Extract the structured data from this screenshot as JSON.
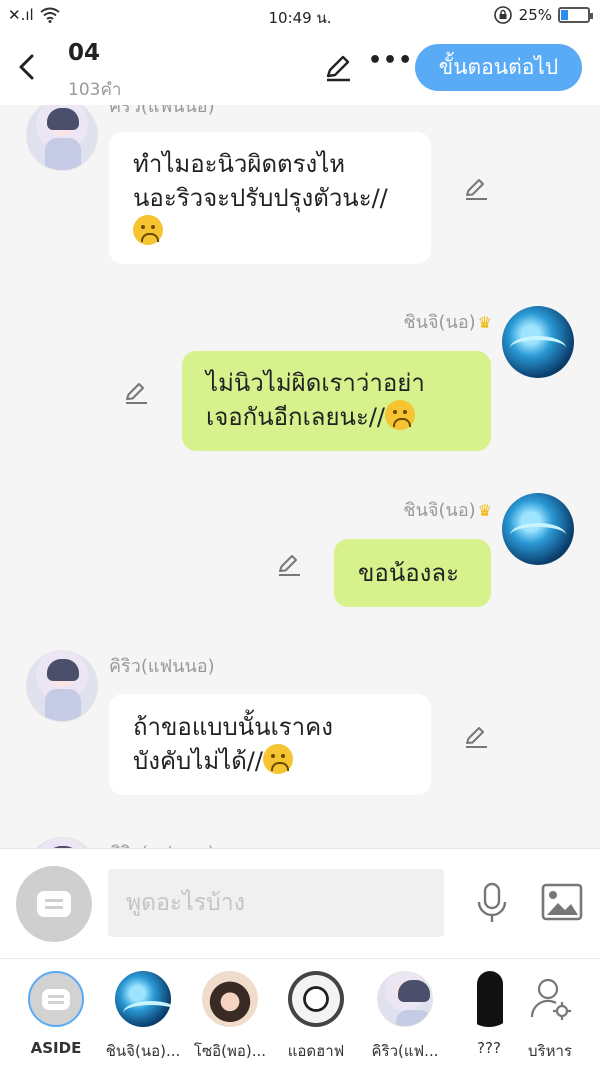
{
  "status_bar": {
    "signal": "✕.ıl",
    "time": "10:49 น.",
    "battery_percent": "25%",
    "battery_level": 0.25
  },
  "header": {
    "back_icon": "chevron-left",
    "title": "04",
    "subtitle": "103คำ",
    "next_button": "ขั้นตอนต่อไป"
  },
  "messages": [
    {
      "side": "left",
      "sender": "คิริว(แฟนนอ)",
      "lines": [
        "ทำไมอะนิวผิดตรงไห",
        "นอะริวจะปรับปรุงตัวนะ//"
      ],
      "emoji": "frowning-face"
    },
    {
      "side": "right",
      "sender": "ชินจิ(นอ)",
      "lines": [
        "ไม่นิวไม่ผิดเราว่าอย่า",
        "เจอกันอีกเลยนะ//"
      ],
      "emoji": "frowning-face"
    },
    {
      "side": "right",
      "sender": "ชินจิ(นอ)",
      "lines": [
        "ขอน้องละ"
      ],
      "emoji": null
    },
    {
      "side": "left",
      "sender": "คิริว(แฟนนอ)",
      "lines": [
        "ถ้าขอแบบนั้นเราคง",
        "บังคับไม่ได้//"
      ],
      "emoji": "frowning-face"
    },
    {
      "side": "left",
      "sender": "คิริว(แฟนนอ)",
      "lines": [],
      "emoji": null
    }
  ],
  "input": {
    "placeholder": "พูดอะไรบ้าง"
  },
  "characters": [
    {
      "label": "ASIDE",
      "style": "aside"
    },
    {
      "label": "ชินจิ(นอ)...",
      "style": "wave"
    },
    {
      "label": "โซอิ(พอ)...",
      "style": "warm"
    },
    {
      "label": "แอดฮาฟ",
      "style": "manga"
    },
    {
      "label": "คิริว(แฟ...",
      "style": "boy"
    },
    {
      "label": "???",
      "style": "dark"
    },
    {
      "label": "บริหาร",
      "style": "manage"
    }
  ],
  "colors": {
    "accent": "#5aabf5",
    "right_bubble": "#d7f28c",
    "left_bubble": "#ffffff",
    "background": "#f5f5f5"
  }
}
